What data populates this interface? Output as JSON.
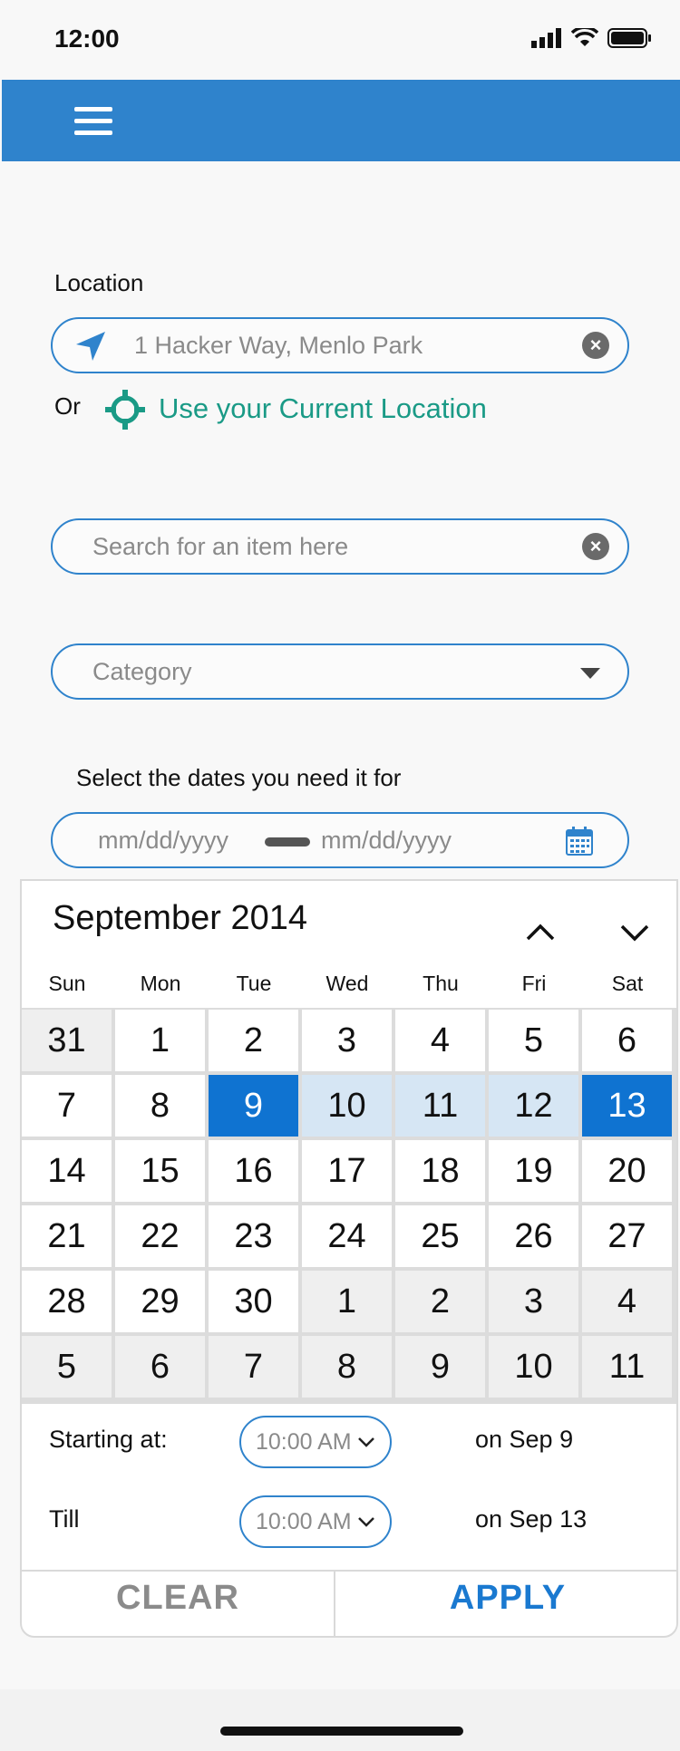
{
  "status_bar": {
    "time": "12:00"
  },
  "location": {
    "label": "Location",
    "value": "1 Hacker Way, Menlo Park",
    "or_text": "Or",
    "current_location_link": "Use your Current Location"
  },
  "search": {
    "placeholder": "Search for an item here"
  },
  "category": {
    "placeholder": "Category"
  },
  "dates": {
    "label": "Select the dates you need it for",
    "start_placeholder": "mm/dd/yyyy",
    "end_placeholder": "mm/dd/yyyy"
  },
  "calendar": {
    "month_title": "September 2014",
    "weekdays": [
      "Sun",
      "Mon",
      "Tue",
      "Wed",
      "Thu",
      "Fri",
      "Sat"
    ],
    "weeks": [
      [
        "31",
        "1",
        "2",
        "3",
        "4",
        "5",
        "6"
      ],
      [
        "7",
        "8",
        "9",
        "10",
        "11",
        "12",
        "13"
      ],
      [
        "14",
        "15",
        "16",
        "17",
        "18",
        "19",
        "20"
      ],
      [
        "21",
        "22",
        "23",
        "24",
        "25",
        "26",
        "27"
      ],
      [
        "28",
        "29",
        "30",
        "1",
        "2",
        "3",
        "4"
      ],
      [
        "5",
        "6",
        "7",
        "8",
        "9",
        "10",
        "11"
      ]
    ],
    "selected_start": "9",
    "selected_end": "13",
    "starting_label": "Starting at:",
    "starting_time": "10:00 AM",
    "starting_date": "on Sep 9",
    "till_label": "Till",
    "till_time": "10:00 AM",
    "till_date": "on Sep 13",
    "clear_label": "CLEAR",
    "apply_label": "APPLY"
  },
  "colors": {
    "app_bar": "#2f83cc",
    "selected": "#0f73d1",
    "range": "#d6e6f4",
    "link": "#1a9a86"
  }
}
